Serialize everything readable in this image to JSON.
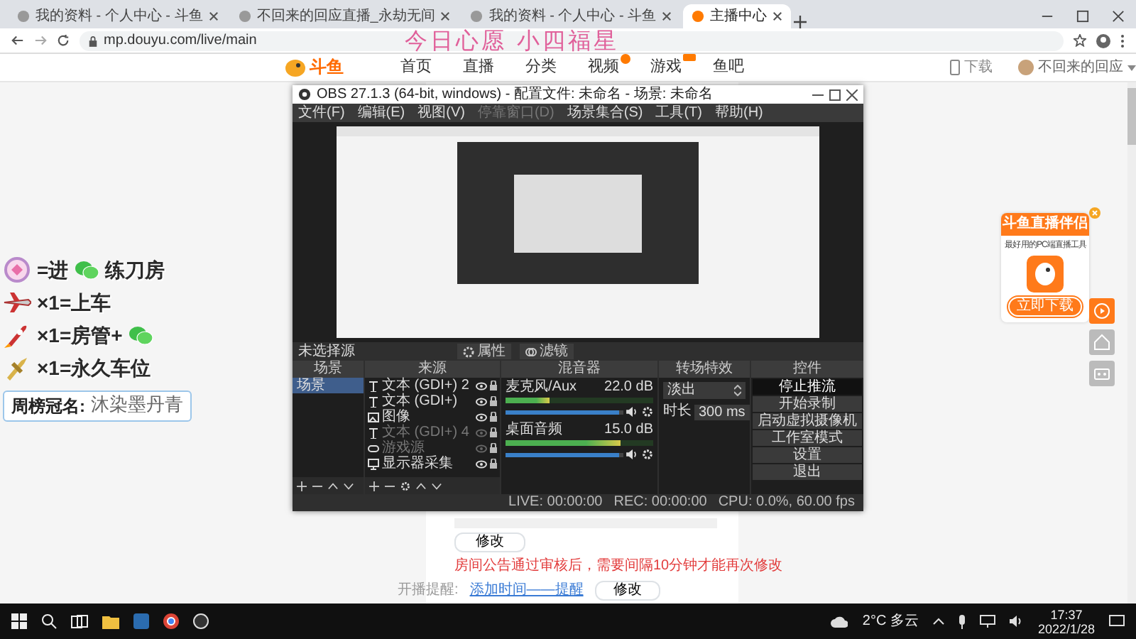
{
  "browser": {
    "tabs": [
      {
        "label": "我的资料 - 个人中心 - 斗鱼",
        "selected": false
      },
      {
        "label": "不回来的回应直播_永劫无间",
        "selected": false
      },
      {
        "label": "我的资料 - 个人中心 - 斗鱼",
        "selected": false
      },
      {
        "label": "主播中心",
        "selected": true
      }
    ],
    "url": "mp.douyu.com/live/main"
  },
  "site": {
    "logo": "斗鱼",
    "nav": [
      {
        "label": "首页",
        "badge": false
      },
      {
        "label": "直播",
        "badge": false
      },
      {
        "label": "分类",
        "badge": false
      },
      {
        "label": "视频",
        "badge": true
      },
      {
        "label": "游戏",
        "badge": true
      },
      {
        "label": "鱼吧",
        "badge": false
      }
    ],
    "download": "下载",
    "user": "不回来的回应"
  },
  "stream_overlay": {
    "wish": "今日心愿 小四福星",
    "rules": [
      {
        "text": "=进",
        "wechat": true,
        "after": "练刀房"
      },
      {
        "text": "×1=上车",
        "wechat": false
      },
      {
        "text": "×1=房管+",
        "wechat": true
      },
      {
        "text": "×1=永久车位",
        "wechat": false
      }
    ],
    "weekly": {
      "label": "周榜冠名:",
      "name": "沐染墨丹青"
    }
  },
  "obs": {
    "title": "OBS 27.1.3 (64-bit, windows) - 配置文件: 未命名 - 场景: 未命名",
    "menu": [
      {
        "label": "文件(F)",
        "disabled": false
      },
      {
        "label": "编辑(E)",
        "disabled": false
      },
      {
        "label": "视图(V)",
        "disabled": false
      },
      {
        "label": "停靠窗口(D)",
        "disabled": true
      },
      {
        "label": "场景集合(S)",
        "disabled": false
      },
      {
        "label": "工具(T)",
        "disabled": false
      },
      {
        "label": "帮助(H)",
        "disabled": false
      }
    ],
    "toolbar": {
      "label": "未选择源",
      "buttons": [
        "属性",
        "滤镜"
      ]
    },
    "panels": [
      "场景",
      "来源",
      "混音器",
      "转场特效",
      "控件"
    ],
    "scenes": [
      {
        "label": "场景",
        "selected": true
      }
    ],
    "sources": [
      {
        "kind": "text",
        "label": "文本 (GDI+) 2",
        "visible": true
      },
      {
        "kind": "text",
        "label": "文本 (GDI+)",
        "visible": true
      },
      {
        "kind": "image",
        "label": "图像",
        "visible": true
      },
      {
        "kind": "text",
        "label": "文本 (GDI+) 4",
        "visible": false
      },
      {
        "kind": "game",
        "label": "游戏源",
        "visible": false
      },
      {
        "kind": "display",
        "label": "显示器采集",
        "visible": true
      }
    ],
    "mixer": [
      {
        "name": "麦克风/Aux",
        "reading": "22.0 dB",
        "meter": {
          "level": 0.3
        },
        "volume": {
          "level": 0.96
        }
      },
      {
        "name": "桌面音频",
        "reading": "15.0 dB",
        "meter": {
          "level": 0.78
        },
        "volume": {
          "level": 0.96
        }
      }
    ],
    "transition": {
      "type": "淡出",
      "duration_label": "时长",
      "duration": "300 ms"
    },
    "controls": [
      {
        "label": "停止推流",
        "active": true
      },
      {
        "label": "开始录制",
        "active": false
      },
      {
        "label": "启动虚拟摄像机",
        "active": false
      },
      {
        "label": "工作室模式",
        "active": false
      },
      {
        "label": "设置",
        "active": false
      },
      {
        "label": "退出",
        "active": false
      }
    ],
    "status": {
      "live": "LIVE: 00:00:00",
      "rec": "REC: 00:00:00",
      "cpu": "CPU: 0.0%, 60.00 fps"
    }
  },
  "page": {
    "edit_button": "修改",
    "notice": "房间公告通过审核后，需要间隔10分钟才能再次修改",
    "reminder_label": "开播提醒:",
    "reminder_link": "添加时间——提醒",
    "reminder_button": "修改"
  },
  "side_widget": {
    "title": "斗鱼直播伴侣",
    "subtitle": "最好用的PC端直播工具",
    "button": "立即下载"
  },
  "taskbar": {
    "weather": "2°C 多云",
    "time": "17:37",
    "date": "2022/1/28"
  }
}
